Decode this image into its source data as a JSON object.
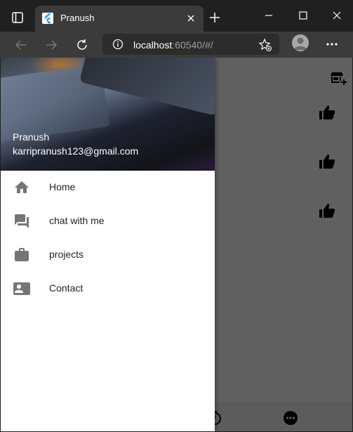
{
  "browser": {
    "tab_title": "Pranush",
    "url_host": "localhost",
    "url_rest": ":60540/#/"
  },
  "drawer": {
    "user_name": "Pranush",
    "user_email": "karripranush123@gmail.com",
    "items": [
      {
        "label": "Home",
        "icon": "home-icon"
      },
      {
        "label": "chat with me",
        "icon": "chat-icon"
      },
      {
        "label": "projects",
        "icon": "briefcase-icon"
      },
      {
        "label": "Contact",
        "icon": "contact-card-icon"
      }
    ]
  },
  "colors": {
    "overlay": "#606060",
    "drawer_bg": "#ffffff",
    "icon_grey": "#757575"
  }
}
